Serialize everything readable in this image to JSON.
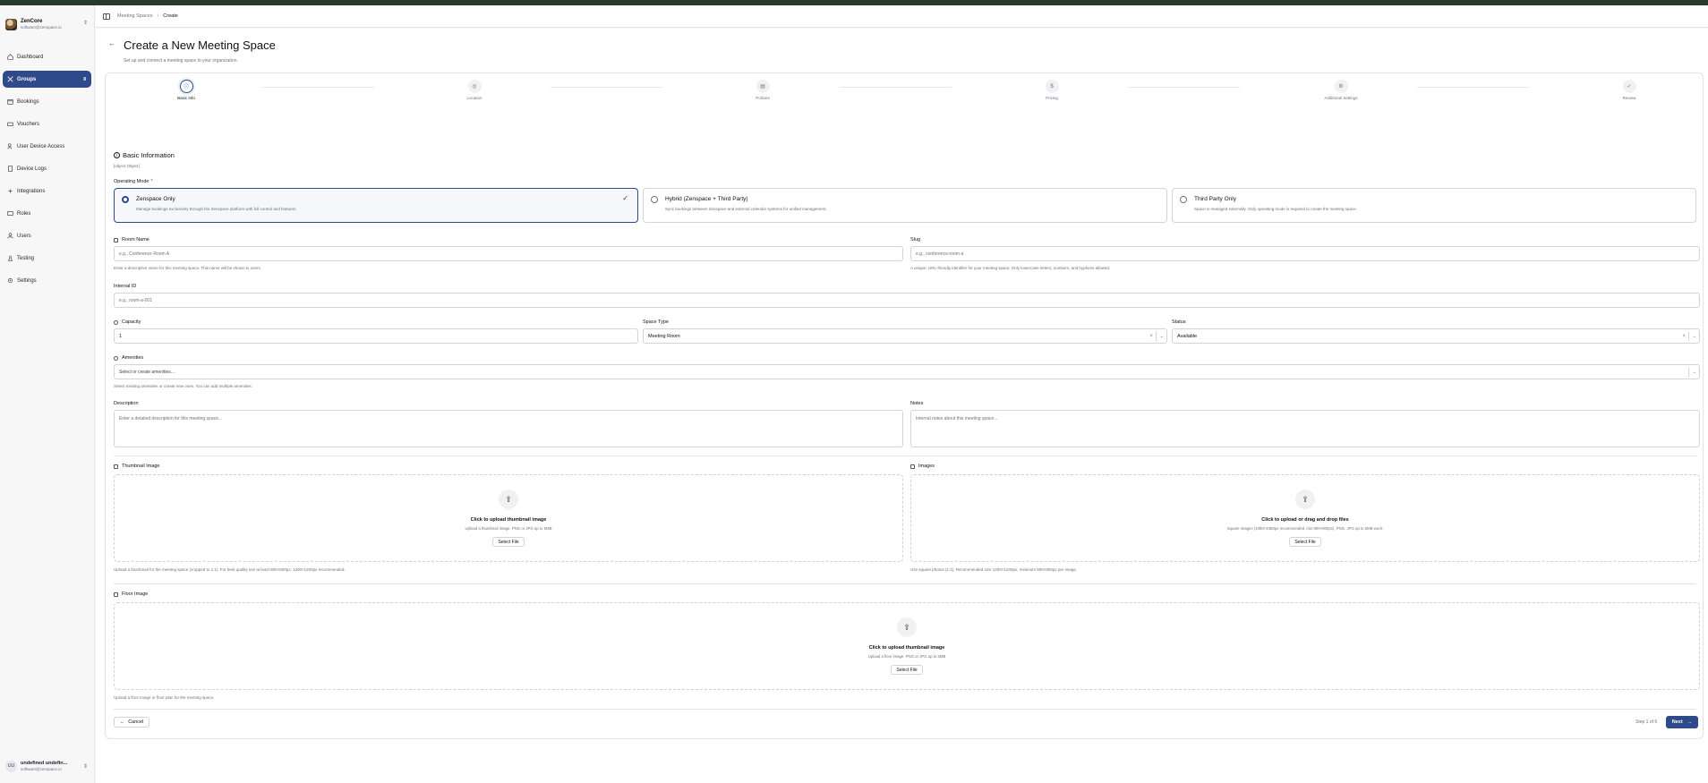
{
  "sidebar": {
    "org_name": "ZenCore",
    "org_email": "software@zenspace.io",
    "items": [
      {
        "label": "Dashboard",
        "icon": "home-icon"
      },
      {
        "label": "Groups",
        "icon": "groups-icon",
        "badge": "8"
      },
      {
        "label": "Bookings",
        "icon": "calendar-icon"
      },
      {
        "label": "Vouchers",
        "icon": "ticket-icon"
      },
      {
        "label": "User Device Access",
        "icon": "user-device-icon"
      },
      {
        "label": "Device Logs",
        "icon": "log-icon"
      },
      {
        "label": "Integrations",
        "icon": "integrations-icon"
      },
      {
        "label": "Roles",
        "icon": "roles-icon"
      },
      {
        "label": "Users",
        "icon": "users-icon"
      },
      {
        "label": "Testing",
        "icon": "testing-icon"
      },
      {
        "label": "Settings",
        "icon": "gear-icon"
      }
    ],
    "user": {
      "initials": "UU",
      "name": "undefined undefin...",
      "email": "software@zenspace.io"
    }
  },
  "header": {
    "breadcrumb": [
      "Meeting Spaces",
      "Create"
    ]
  },
  "page": {
    "title": "Create a New Meeting Space",
    "subtitle": "Set up and connect a meeting space to your organization."
  },
  "stepper": {
    "steps": [
      "Basic Info",
      "Location",
      "Policies",
      "Pricing",
      "Additional Settings",
      "Review"
    ],
    "current": 1
  },
  "basic": {
    "title": "Basic Information",
    "description": {
      "label": "Description",
      "placeholder": "Enter a detailed description for this meeting space..."
    },
    "operating_mode_label": "Operating Mode",
    "modes": [
      {
        "title": "Zenspace Only",
        "desc": "Manage bookings exclusively through the Zenspace platform with full control and features."
      },
      {
        "title": "Hybrid (Zenspace + Third Party)",
        "desc": "Sync bookings between Zenspace and external calendar systems for unified management."
      },
      {
        "title": "Third Party Only",
        "desc": "Space is managed externally. Only operating mode is required to create the meeting space."
      }
    ],
    "room_name": {
      "label": "Room Name",
      "placeholder": "e.g., Conference Room A",
      "hint": "Enter a descriptive name for this meeting space. This name will be shown to users."
    },
    "slug": {
      "label": "Slug",
      "placeholder": "e.g., conference-room-a",
      "hint": "A unique, URL-friendly identifier for your meeting space. Only lowercase letters, numbers, and hyphens allowed."
    },
    "internal_id": {
      "label": "Internal ID",
      "placeholder": "e.g., room-a-001"
    },
    "capacity": {
      "label": "Capacity",
      "value": "1"
    },
    "space_type": {
      "label": "Space Type",
      "value": "Meeting Room"
    },
    "status": {
      "label": "Status",
      "value": "Available"
    },
    "amenities": {
      "label": "Amenities",
      "placeholder": "Select or create amenities...",
      "hint": "Select existing amenities or create new ones. You can add multiple amenities."
    },
    "notes": {
      "label": "Notes",
      "placeholder": "Internal notes about this meeting space..."
    }
  },
  "uploads": {
    "thumbnail": {
      "label": "Thumbnail Image",
      "title": "Click to upload thumbnail image",
      "sub": "Upload a thumbnail image. PNG or JPG up to 5MB",
      "button": "Select File",
      "hint": "Upload a thumbnail for the meeting space (cropped to 1:1). For best quality use at least 800×800px; 1200×1200px recommended."
    },
    "images": {
      "label": "Images",
      "title": "Click to upload or drag and drop files",
      "sub": "Square images (1080×1080px recommended, min 800×800px). PNG, JPG up to 5MB each.",
      "button": "Select File",
      "hint": "Use square photos (1:1). Recommended size 1200×1200px; minimum 800×800px per image."
    },
    "floor": {
      "label": "Floor Image",
      "title": "Click to upload thumbnail image",
      "sub": "Upload a floor image. PNG or JPG up to 5MB",
      "button": "Select File",
      "hint": "Upload a floor image or floor plan for the meeting space."
    }
  },
  "footer": {
    "cancel": "Cancel",
    "step_of": "Step 1 of 6",
    "next": "Next"
  },
  "colors": {
    "accent": "#2e4a8a",
    "topbar": "#283a2e"
  }
}
